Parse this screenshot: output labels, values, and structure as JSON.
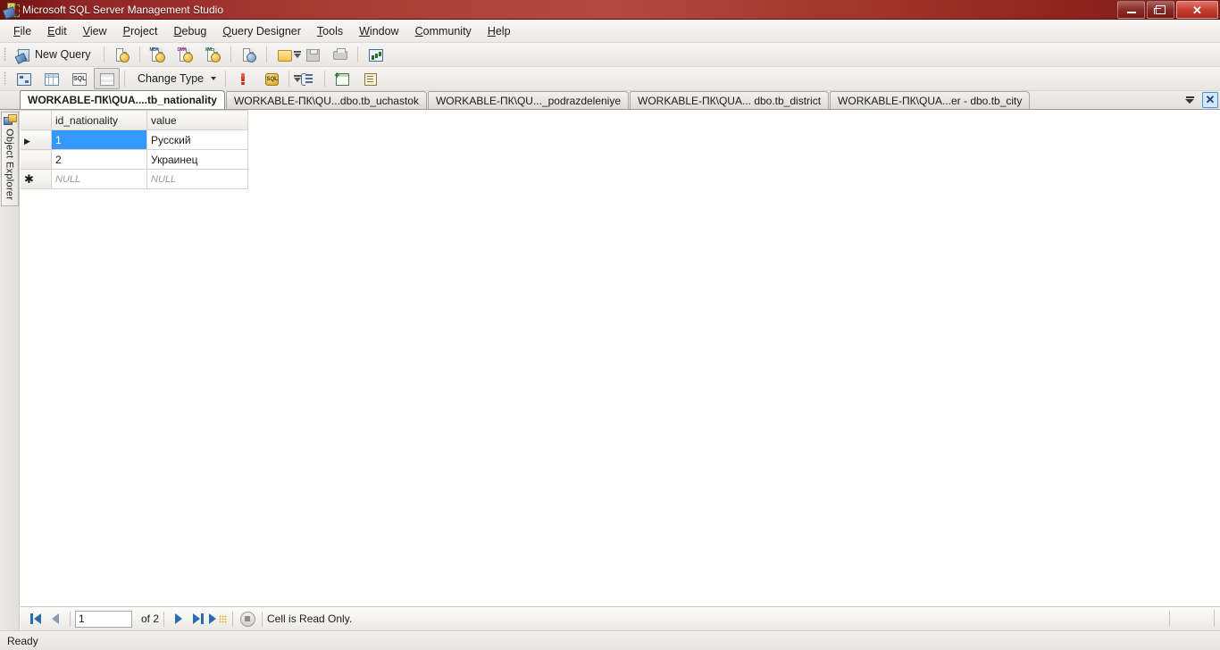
{
  "window": {
    "title": "Microsoft SQL Server Management Studio",
    "app_icon": "ssms-icon",
    "buttons": {
      "minimize": "minimize-button",
      "restore": "restore-button",
      "close": "close-button"
    }
  },
  "menubar": {
    "items": [
      {
        "label": "File",
        "accel": "F"
      },
      {
        "label": "Edit",
        "accel": "E"
      },
      {
        "label": "View",
        "accel": "V"
      },
      {
        "label": "Project",
        "accel": "P"
      },
      {
        "label": "Debug",
        "accel": "D"
      },
      {
        "label": "Query Designer",
        "accel": "Q"
      },
      {
        "label": "Tools",
        "accel": "T"
      },
      {
        "label": "Window",
        "accel": "W"
      },
      {
        "label": "Community",
        "accel": "C"
      },
      {
        "label": "Help",
        "accel": "H"
      }
    ]
  },
  "toolbar_standard": {
    "new_query_label": "New Query",
    "icons": [
      "new-query-icon",
      "new-database-engine-query-icon",
      "new-analysis-services-mdx-query-icon",
      "new-analysis-services-dmx-query-icon",
      "new-analysis-services-xmla-query-icon",
      "new-sql-server-compact-query-icon",
      "open-file-icon",
      "save-icon",
      "print-icon",
      "activity-monitor-icon"
    ],
    "overflow": "toolbar-overflow-icon"
  },
  "toolbar_query_designer": {
    "change_type_label": "Change Type",
    "icons": [
      "show-diagram-pane-icon",
      "show-criteria-pane-icon",
      "show-sql-pane-icon",
      "show-results-pane-icon",
      "execute-sql-icon",
      "verify-sql-syntax-icon",
      "group-by-icon",
      "add-table-icon",
      "property-pages-icon"
    ],
    "overflow": "toolbar-overflow-icon"
  },
  "document_tabs": {
    "tabs": [
      {
        "label": "WORKABLE-ПК\\QUA....tb_nationality",
        "active": true
      },
      {
        "label": "WORKABLE-ПК\\QU...dbo.tb_uchastok",
        "active": false
      },
      {
        "label": "WORKABLE-ПК\\QU..._podrazdeleniye",
        "active": false
      },
      {
        "label": "WORKABLE-ПК\\QUA... dbo.tb_district",
        "active": false
      },
      {
        "label": "WORKABLE-ПК\\QUA...er - dbo.tb_city",
        "active": false
      }
    ],
    "dropdown_icon": "active-files-dropdown-icon",
    "close_icon": "close-document-icon"
  },
  "object_explorer": {
    "label": "Object Explorer",
    "icon": "object-explorer-icon"
  },
  "grid": {
    "columns": [
      "",
      "id_nationality",
      "value"
    ],
    "rows": [
      {
        "selector": "current-row-indicator",
        "cells": [
          "1",
          "Русский"
        ],
        "selected_cell_index": 0,
        "null_row": false
      },
      {
        "selector": "",
        "cells": [
          "2",
          "Украинец"
        ],
        "selected_cell_index": -1,
        "null_row": false
      },
      {
        "selector": "new-row-indicator",
        "cells": [
          "NULL",
          "NULL"
        ],
        "selected_cell_index": -1,
        "null_row": true
      }
    ],
    "selection_color": "#3399ff"
  },
  "navbar": {
    "first_icon": "move-first-icon",
    "prev_icon": "move-previous-icon",
    "row_value": "1",
    "of_label": "of 2",
    "next_icon": "move-next-icon",
    "last_icon": "move-last-icon",
    "new_row_icon": "move-to-new-row-icon",
    "stop_icon": "stop-icon",
    "status": "Cell is Read Only."
  },
  "statusbar": {
    "text": "Ready"
  }
}
